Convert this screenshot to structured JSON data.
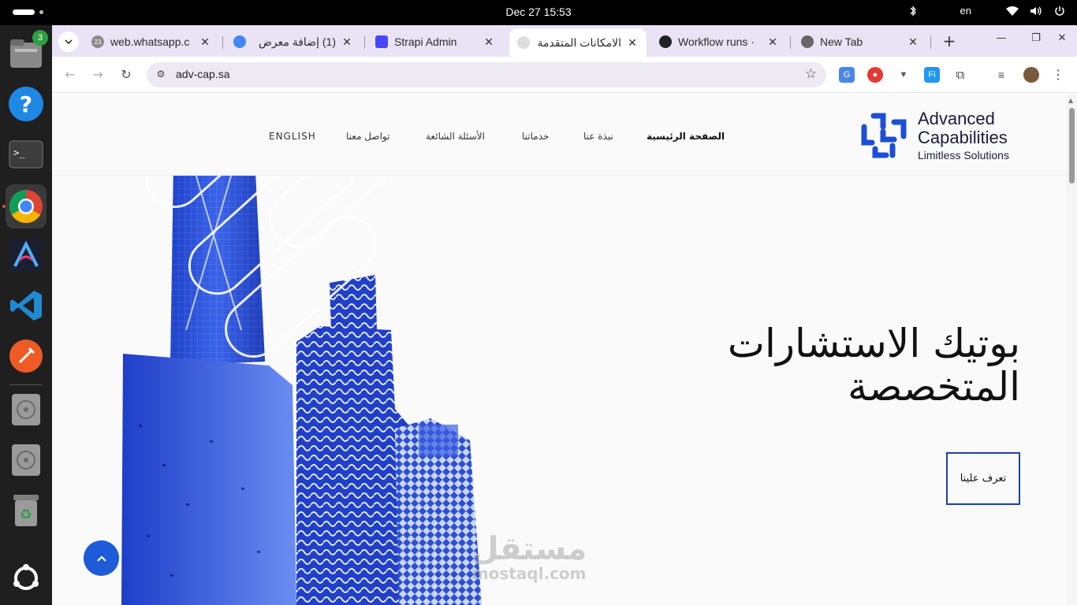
{
  "system": {
    "clock": "Dec 27  15:53",
    "language": "en"
  },
  "dock": {
    "files_badge": "3",
    "items": [
      "files-icon",
      "help-icon",
      "terminal-icon",
      "chrome-icon",
      "arduino-icon",
      "vscode-icon",
      "postman-icon",
      "disk-icon",
      "disk-icon",
      "trash-icon",
      "ubuntu-icon"
    ]
  },
  "browser": {
    "tabs": [
      {
        "title": "web.whatsapp.c",
        "badge": "23"
      },
      {
        "title": "(1) إضافة معرض"
      },
      {
        "title": "Strapi Admin"
      },
      {
        "title": "الامكانات المتقدمة"
      },
      {
        "title": "Workflow runs ·"
      },
      {
        "title": "New Tab"
      }
    ],
    "url": "adv-cap.sa"
  },
  "site": {
    "logo_line1": "Advanced",
    "logo_line2": "Capabilities",
    "logo_line3": "Limitless Solutions",
    "nav": {
      "home": "الصفحة الرئيسية",
      "about": "نبذة عنا",
      "services": "خدماتنا",
      "faq": "الأسئلة الشائعة",
      "contact": "تواصل معنا",
      "english": "ENGLISH"
    },
    "hero_line1": "بوتيك الاستشارات",
    "hero_line2": "المتخصصة",
    "cta": "تعرف علينا",
    "watermark_ar": "مستقل",
    "watermark_lat": "mostaql.com"
  },
  "colors": {
    "brand_blue": "#1d5bd8",
    "cta_border": "#1d3fa8",
    "tabstrip": "#e9e3f5"
  }
}
